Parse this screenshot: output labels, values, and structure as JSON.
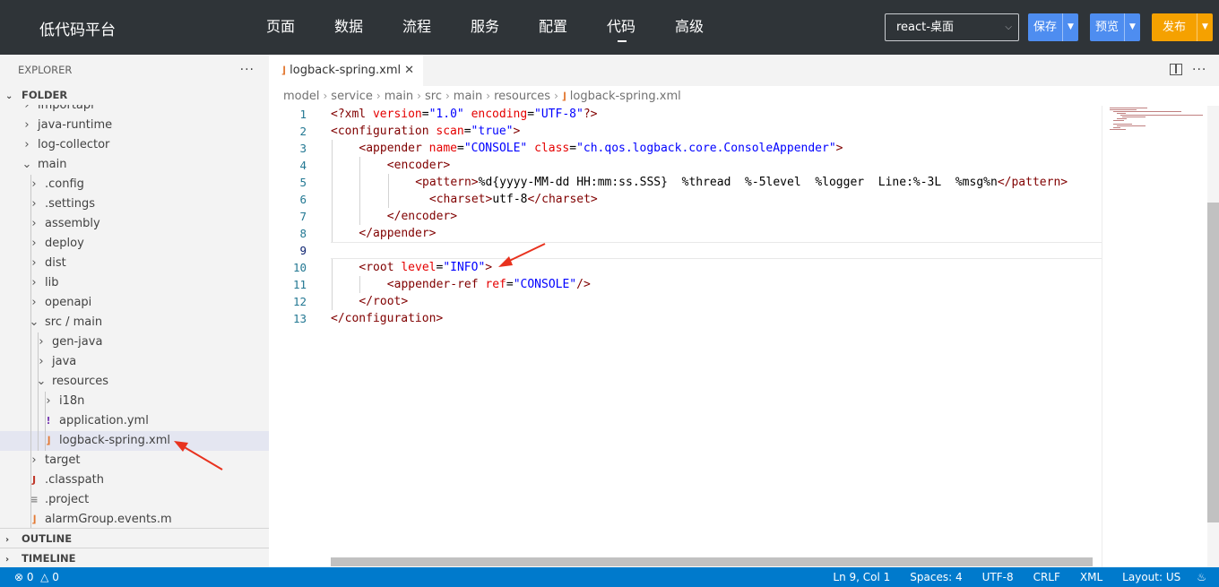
{
  "topbar": {
    "brand": "低代码平台",
    "nav": [
      "页面",
      "数据",
      "流程",
      "服务",
      "配置",
      "代码",
      "高级"
    ],
    "active_nav": "代码",
    "env_select": "react-桌面",
    "save_label": "保存",
    "preview_label": "预览",
    "publish_label": "发布",
    "colors": {
      "bg": "#2f3438",
      "primary": "#4e8df0",
      "publish": "#f5a100"
    }
  },
  "sidebar": {
    "explorer_label": "EXPLORER",
    "folder_label": "FOLDER",
    "tree": [
      {
        "label": "importapi",
        "depth": 1,
        "kind": "folder"
      },
      {
        "label": "java-runtime",
        "depth": 1,
        "kind": "folder"
      },
      {
        "label": "log-collector",
        "depth": 1,
        "kind": "folder"
      },
      {
        "label": "main",
        "depth": 1,
        "kind": "folder-open"
      },
      {
        "label": ".config",
        "depth": 2,
        "kind": "folder"
      },
      {
        "label": ".settings",
        "depth": 2,
        "kind": "folder"
      },
      {
        "label": "assembly",
        "depth": 2,
        "kind": "folder"
      },
      {
        "label": "deploy",
        "depth": 2,
        "kind": "folder"
      },
      {
        "label": "dist",
        "depth": 2,
        "kind": "folder"
      },
      {
        "label": "lib",
        "depth": 2,
        "kind": "folder"
      },
      {
        "label": "openapi",
        "depth": 2,
        "kind": "folder"
      },
      {
        "label": "src / main",
        "depth": 2,
        "kind": "folder-open"
      },
      {
        "label": "gen-java",
        "depth": 3,
        "kind": "folder"
      },
      {
        "label": "java",
        "depth": 3,
        "kind": "folder"
      },
      {
        "label": "resources",
        "depth": 3,
        "kind": "folder-open"
      },
      {
        "label": "i18n",
        "depth": 4,
        "kind": "folder"
      },
      {
        "label": "application.yml",
        "depth": 4,
        "kind": "yml-file"
      },
      {
        "label": "logback-spring.xml",
        "depth": 4,
        "kind": "xml-file",
        "selected": true
      },
      {
        "label": "target",
        "depth": 2,
        "kind": "folder"
      },
      {
        "label": ".classpath",
        "depth": 2,
        "kind": "java-file"
      },
      {
        "label": ".project",
        "depth": 2,
        "kind": "text-file"
      },
      {
        "label": "alarmGroup.events.m",
        "depth": 2,
        "kind": "xml-file"
      }
    ],
    "outline_label": "OUTLINE",
    "timeline_label": "TIMELINE"
  },
  "editor": {
    "tab_label": "logback-spring.xml",
    "breadcrumb": [
      "model",
      "service",
      "main",
      "src",
      "main",
      "resources",
      "logback-spring.xml"
    ],
    "current_line": 9,
    "lines": [
      {
        "n": "1",
        "indent": 0,
        "tokens": [
          [
            "t-tag",
            "<?xml "
          ],
          [
            "t-attr",
            "version"
          ],
          [
            "t-text",
            "="
          ],
          [
            "t-str",
            "\"1.0\""
          ],
          [
            "t-text",
            " "
          ],
          [
            "t-attr",
            "encoding"
          ],
          [
            "t-text",
            "="
          ],
          [
            "t-str",
            "\"UTF-8\""
          ],
          [
            "t-tag",
            "?>"
          ]
        ]
      },
      {
        "n": "2",
        "indent": 0,
        "tokens": [
          [
            "t-tag",
            "<configuration "
          ],
          [
            "t-attr",
            "scan"
          ],
          [
            "t-text",
            "="
          ],
          [
            "t-str",
            "\"true\""
          ],
          [
            "t-tag",
            ">"
          ]
        ]
      },
      {
        "n": "3",
        "indent": 1,
        "tokens": [
          [
            "t-tag",
            "<appender "
          ],
          [
            "t-attr",
            "name"
          ],
          [
            "t-text",
            "="
          ],
          [
            "t-str",
            "\"CONSOLE\""
          ],
          [
            "t-text",
            " "
          ],
          [
            "t-attr",
            "class"
          ],
          [
            "t-text",
            "="
          ],
          [
            "t-str",
            "\"ch.qos.logback.core.ConsoleAppender\""
          ],
          [
            "t-tag",
            ">"
          ]
        ]
      },
      {
        "n": "4",
        "indent": 2,
        "tokens": [
          [
            "t-tag",
            "<encoder>"
          ]
        ]
      },
      {
        "n": "5",
        "indent": 3,
        "tokens": [
          [
            "t-tag",
            "<pattern>"
          ],
          [
            "t-text",
            "%d{yyyy-MM-dd HH:mm:ss.SSS}  %thread  %-5level  %logger  Line:%-3L  %msg%n"
          ],
          [
            "t-tag",
            "</pattern>"
          ]
        ]
      },
      {
        "n": "6",
        "indent": 3.5,
        "tokens": [
          [
            "t-tag",
            "<charset>"
          ],
          [
            "t-text",
            "utf-8"
          ],
          [
            "t-tag",
            "</charset>"
          ]
        ]
      },
      {
        "n": "7",
        "indent": 2,
        "tokens": [
          [
            "t-tag",
            "</encoder>"
          ]
        ]
      },
      {
        "n": "8",
        "indent": 1,
        "tokens": [
          [
            "t-tag",
            "</appender>"
          ]
        ]
      },
      {
        "n": "9",
        "indent": 0,
        "tokens": []
      },
      {
        "n": "10",
        "indent": 1,
        "tokens": [
          [
            "t-tag",
            "<root "
          ],
          [
            "t-attr",
            "level"
          ],
          [
            "t-text",
            "="
          ],
          [
            "t-str",
            "\"INFO\""
          ],
          [
            "t-tag",
            ">"
          ]
        ]
      },
      {
        "n": "11",
        "indent": 2,
        "tokens": [
          [
            "t-tag",
            "<appender-ref "
          ],
          [
            "t-attr",
            "ref"
          ],
          [
            "t-text",
            "="
          ],
          [
            "t-str",
            "\"CONSOLE\""
          ],
          [
            "t-tag",
            "/>"
          ]
        ]
      },
      {
        "n": "12",
        "indent": 1,
        "tokens": [
          [
            "t-tag",
            "</root>"
          ]
        ]
      },
      {
        "n": "13",
        "indent": 0,
        "tokens": [
          [
            "t-tag",
            "</configuration>"
          ]
        ]
      }
    ]
  },
  "statusbar": {
    "errors": "0",
    "warnings": "0",
    "position": "Ln 9, Col 1",
    "spaces": "Spaces: 4",
    "encoding": "UTF-8",
    "eol": "CRLF",
    "language": "XML",
    "layout": "Layout: US"
  }
}
